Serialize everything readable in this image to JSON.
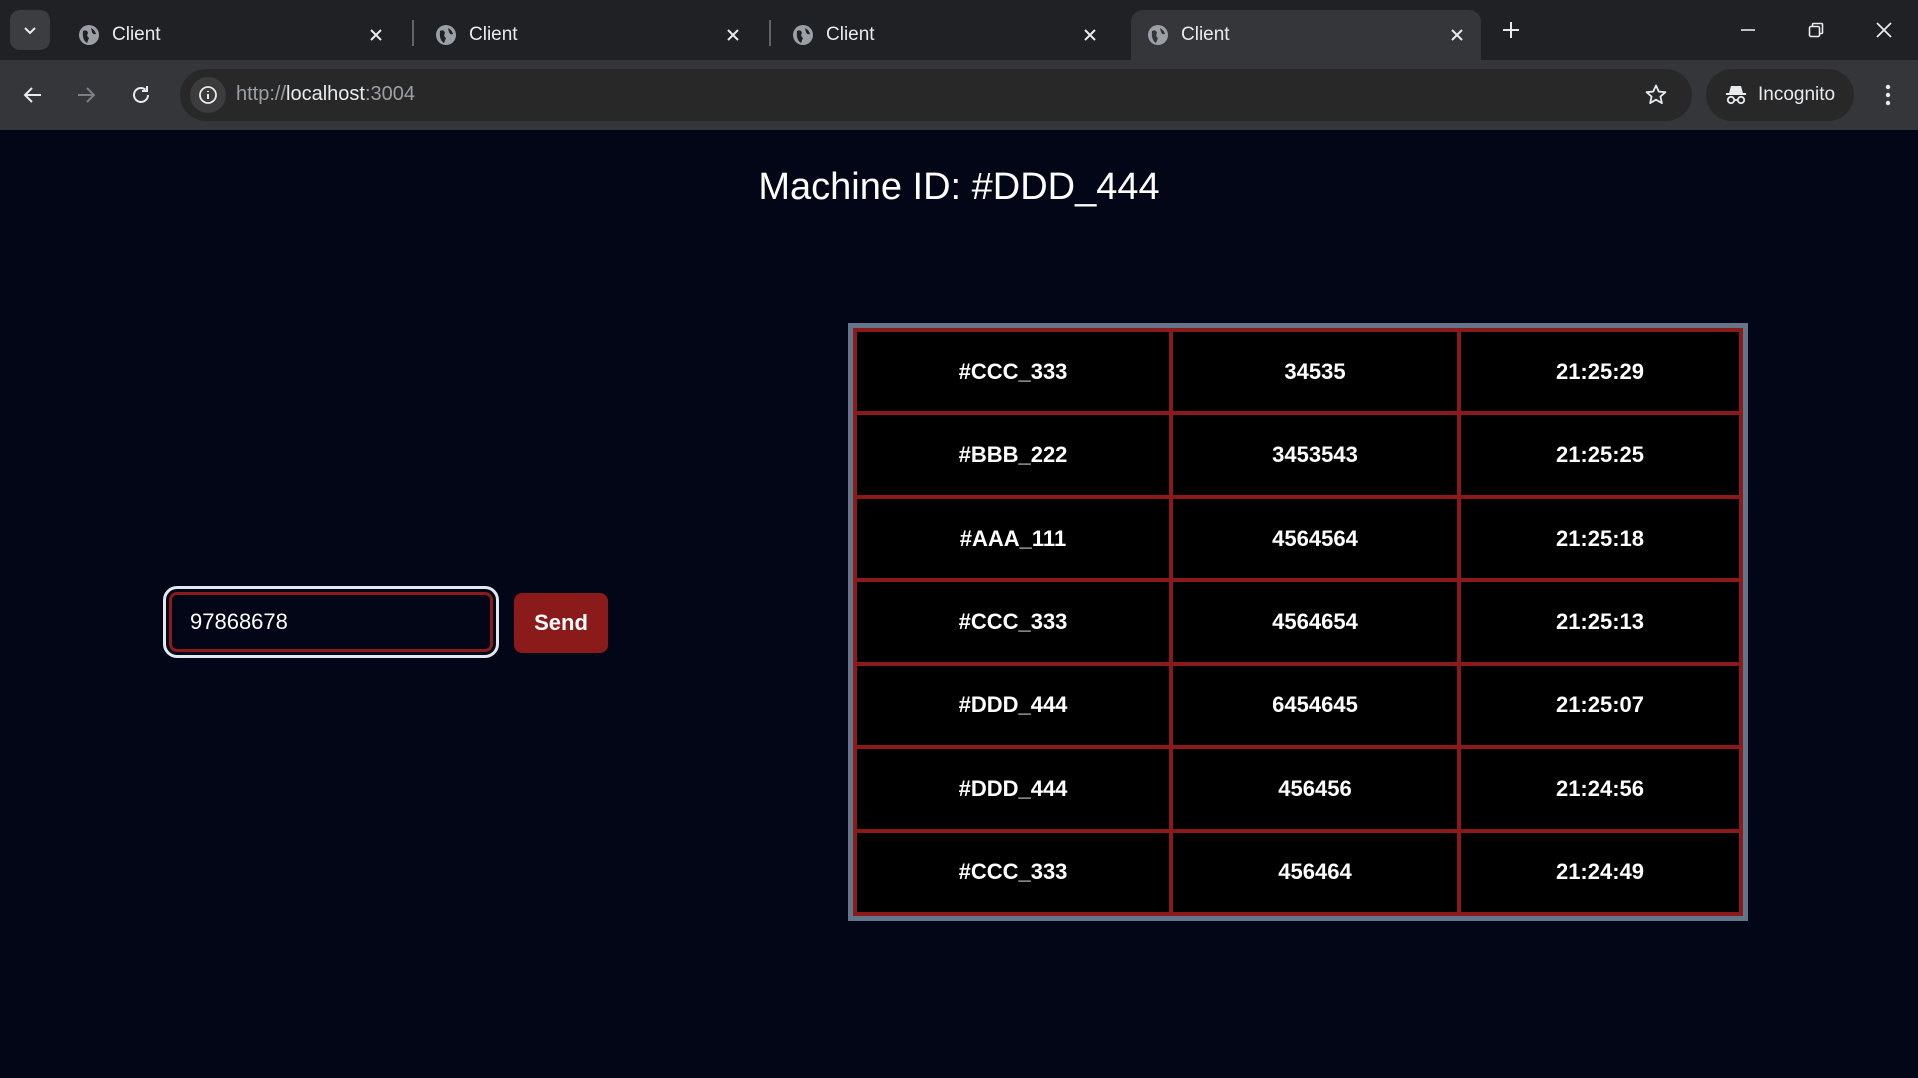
{
  "browser": {
    "tabs": [
      {
        "title": "Client",
        "active": false
      },
      {
        "title": "Client",
        "active": false
      },
      {
        "title": "Client",
        "active": false
      },
      {
        "title": "Client",
        "active": true
      }
    ],
    "url_scheme": "http://",
    "url_host": "localhost",
    "url_port": ":3004",
    "incognito_label": "Incognito",
    "icons": [
      "tab-search-icon",
      "globe-icon",
      "close-icon",
      "new-tab-icon",
      "minimize-icon",
      "restore-icon",
      "window-close-icon",
      "back-icon",
      "forward-icon",
      "reload-icon",
      "site-info-icon",
      "bookmark-star-icon",
      "incognito-icon",
      "menu-icon"
    ]
  },
  "page": {
    "heading": "Machine ID: #DDD_444",
    "input_value": "97868678",
    "send_label": "Send"
  },
  "table": {
    "rows": [
      [
        "#CCC_333",
        "34535",
        "21:25:29"
      ],
      [
        "#BBB_222",
        "3453543",
        "21:25:25"
      ],
      [
        "#AAA_111",
        "4564564",
        "21:25:18"
      ],
      [
        "#CCC_333",
        "4564654",
        "21:25:13"
      ],
      [
        "#DDD_444",
        "6454645",
        "21:25:07"
      ],
      [
        "#DDD_444",
        "456456",
        "21:24:56"
      ],
      [
        "#CCC_333",
        "456464",
        "21:24:49"
      ]
    ]
  },
  "colors": {
    "page_bg": "#020617",
    "accent_red": "#8b1a1a",
    "table_frame": "#64748b",
    "cell_bg": "#000000",
    "text": "#ffffff"
  }
}
